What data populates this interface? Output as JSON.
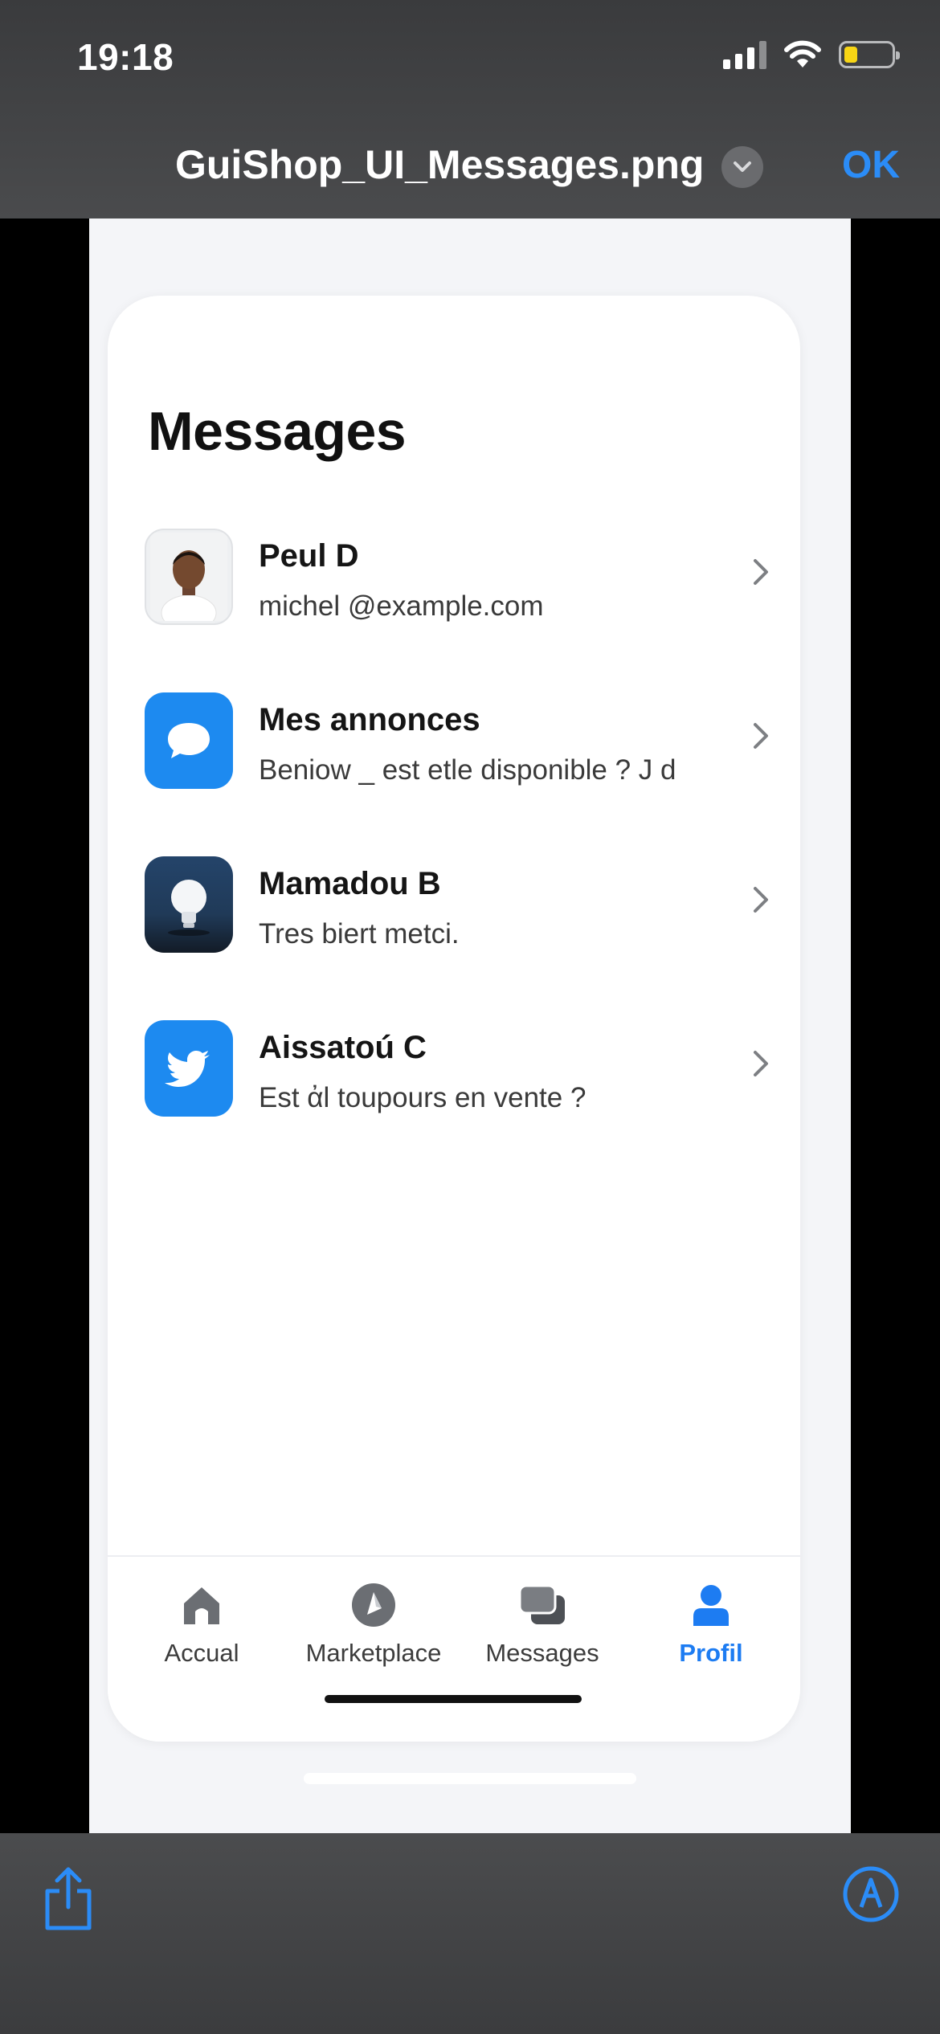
{
  "status_bar": {
    "time": "19:18"
  },
  "viewer": {
    "file_title": "GuiShop_UI_Messages.png",
    "ok_label": "OK",
    "accent": "#2b8cf7"
  },
  "app": {
    "title": "Messages",
    "messages": [
      {
        "name": "Peul D",
        "preview": "michel @example.com",
        "avatar": "person-photo"
      },
      {
        "name": "Mes annonces",
        "preview": "Beniow _ est etle disponible ? J d",
        "avatar": "chat-bubble-icon"
      },
      {
        "name": "Mamadou B",
        "preview": "Tres biert metci.",
        "avatar": "lightbulb-icon"
      },
      {
        "name": "Aissatoú C",
        "preview": "Est ἀl toupours en vente ?",
        "avatar": "twitter-bird-icon"
      }
    ],
    "tabs": [
      {
        "label": "Accual",
        "icon": "home-icon",
        "active": false
      },
      {
        "label": "Marketplace",
        "icon": "compass-icon",
        "active": false
      },
      {
        "label": "Messages",
        "icon": "chat-icon",
        "active": false
      },
      {
        "label": "Profil",
        "icon": "person-icon",
        "active": true
      }
    ],
    "active_tab_color": "#1d7cf2"
  }
}
